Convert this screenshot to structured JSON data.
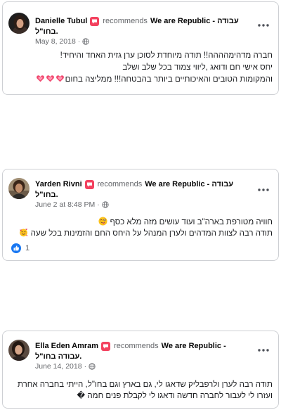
{
  "colors": {
    "primary_text": "#050505",
    "secondary_text": "#65676b",
    "card_border": "#ced0d4",
    "recommend_badge": "#f3425f",
    "like_blue": "#1877f2"
  },
  "icons": {
    "recommend": "recommend-icon",
    "privacy": "globe-icon",
    "menu": "more-options-icon",
    "reaction": "like-icon"
  },
  "cards": [
    {
      "author": "Danielle Tubul",
      "action": "recommends",
      "page_name_line1": "We are Republic - עבודה",
      "page_name_line2": "בחו\"ל.",
      "date": "May 8, 2018",
      "date_separator": "·",
      "body": [
        {
          "text": "חברה מדהימהההה!! תודה מיוחדת לסוכן ערן גזית האחד והיחיד!",
          "emoji": []
        },
        {
          "text": "יחס אישי חם ודואג ,ליווי צמוד בכל שלב ושלב",
          "emoji": []
        },
        {
          "text": "והמקומות הטובים והאיכותיים ביותר בהבטחה!!! ממליצה בחום",
          "emoji": [
            "beating-heart-emoji",
            "beating-heart-emoji",
            "beating-heart-emoji"
          ]
        }
      ]
    },
    {
      "author": "Yarden Rivni",
      "action": "recommends",
      "page_name_line1": "We are Republic - עבודה",
      "page_name_line2": "בחו\"ל.",
      "date": "June 2 at 8:48 PM",
      "date_separator": "·",
      "body": [
        {
          "text": "חוויה מטורפת בארה\"ב ועוד עושים מזה מלא כסף",
          "emoji": [
            "winking-face-with-tongue-emoji"
          ]
        },
        {
          "text": "תודה רבה לצוות המדהים ולערן המנהל על היחס החם והזמינות בכל שעה",
          "emoji": [
            "smiling-face-with-hearts-emoji"
          ]
        }
      ],
      "reactions": {
        "icon": "like-icon",
        "count": "1"
      }
    },
    {
      "author": "Ella Eden Amram",
      "action": "recommends",
      "page_name_line1": "We are Republic -",
      "page_name_line2": "עבודה בחו\"ל.",
      "date": "June 14, 2018",
      "date_separator": "·",
      "body": [
        {
          "text": "תודה רבה לערן ולרפבליק שדאגו לי, גם בארץ וגם בחו\"ל, הייתי בחברה אחרת",
          "emoji": []
        },
        {
          "text": "ועזרו לי לעבור לחברה חדשה ודאגו לי לקבלת פנים חמה �",
          "emoji": []
        }
      ]
    }
  ]
}
